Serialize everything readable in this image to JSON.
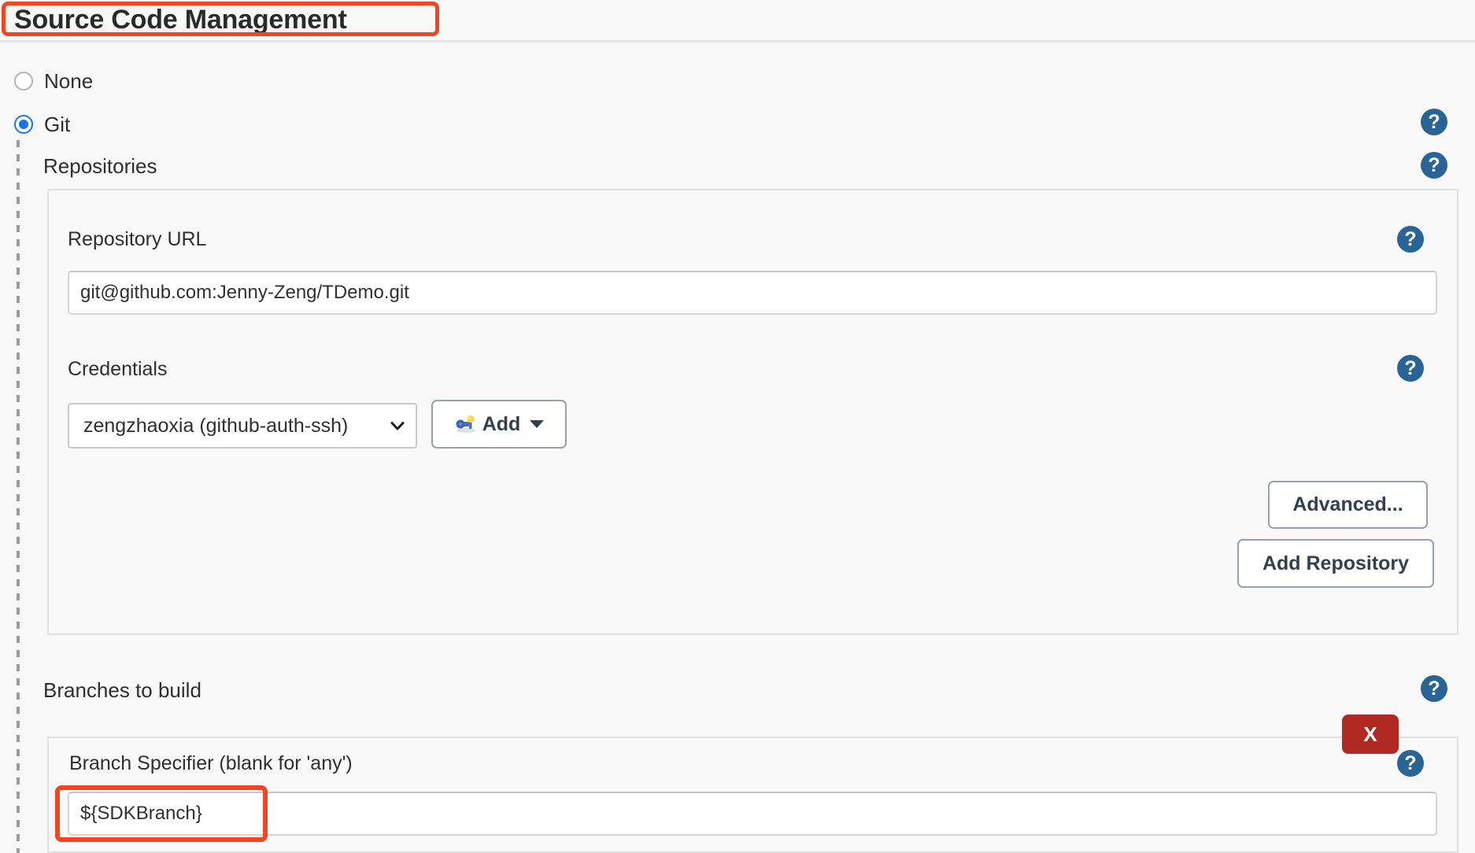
{
  "page": {
    "title": "Source Code Management"
  },
  "scm_options": [
    {
      "label": "None",
      "selected": false
    },
    {
      "label": "Git",
      "selected": true
    }
  ],
  "repositories": {
    "group_label": "Repositories",
    "repository_url": {
      "label": "Repository URL",
      "value": "git@github.com:Jenny-Zeng/TDemo.git",
      "placeholder": ""
    },
    "credentials": {
      "label": "Credentials",
      "selected_value": "zengzhaoxia (github-auth-ssh)",
      "add_button_label": "Add",
      "add_button_icon": "key-icon",
      "caret_icon": "caret-down-icon"
    },
    "advanced_button_label": "Advanced...",
    "add_repository_button_label": "Add Repository"
  },
  "branches": {
    "group_label": "Branches to build",
    "delete_button_label": "X",
    "branch_specifier": {
      "label": "Branch Specifier (blank for 'any')",
      "value": "${SDKBranch}",
      "placeholder": ""
    }
  },
  "help_icons": {
    "glyph": "?",
    "name": "help-icon"
  },
  "colors": {
    "accent_blue": "#1a73e8",
    "help_blue": "#2a6496",
    "annotation_red": "#f04624",
    "delete_red": "#b02a23",
    "page_background": "#f8f8f8"
  }
}
